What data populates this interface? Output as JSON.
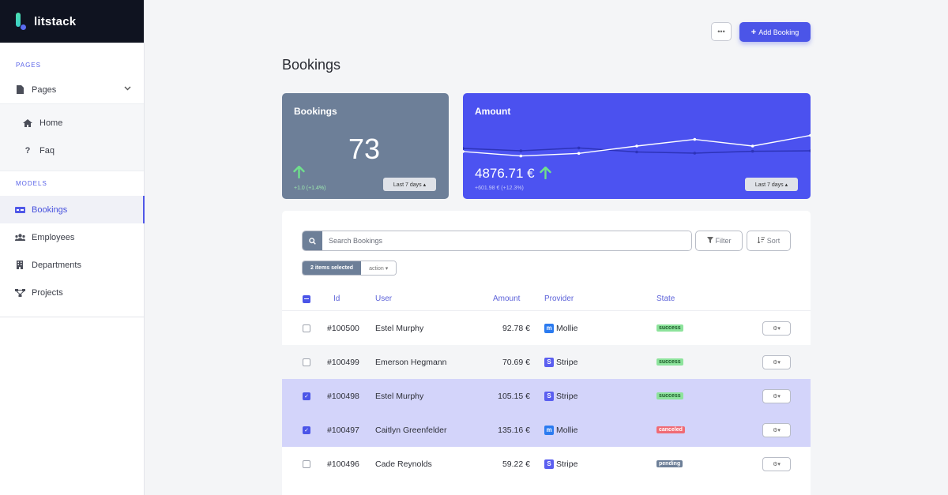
{
  "app": {
    "name": "litstack"
  },
  "sidebar": {
    "pages_label": "PAGES",
    "pages_group": "Pages",
    "pages": [
      {
        "label": "Home",
        "icon": "home-icon"
      },
      {
        "label": "Faq",
        "icon": "question-icon"
      }
    ],
    "models_label": "MODELS",
    "models": [
      {
        "label": "Bookings",
        "icon": "bookings-icon",
        "active": true
      },
      {
        "label": "Employees",
        "icon": "users-icon"
      },
      {
        "label": "Departments",
        "icon": "building-icon"
      },
      {
        "label": "Projects",
        "icon": "network-icon"
      }
    ]
  },
  "header": {
    "more_label": "•••",
    "add_label": "Add Booking",
    "title": "Bookings"
  },
  "cards": {
    "bookings": {
      "title": "Bookings",
      "value": "73",
      "delta": "+1.0 (+1.4%)",
      "range": "Last 7 days ▴"
    },
    "amount": {
      "title": "Amount",
      "value": "4876.71 €",
      "delta": "+601.98 € (+12.3%)",
      "range": "Last 7 days ▴"
    }
  },
  "chart_data": {
    "type": "line",
    "title": "Amount",
    "x": [
      1,
      2,
      3,
      4,
      5,
      6,
      7
    ],
    "series": [
      {
        "values": [
          0.4,
          0.3,
          0.42,
          0.25,
          0.2,
          0.28,
          0.3
        ]
      },
      {
        "values": [
          0.27,
          0.08,
          0.19,
          0.5,
          0.78,
          0.5,
          0.95
        ]
      }
    ],
    "grid": false,
    "axes_visible": false
  },
  "toolbar": {
    "search_placeholder": "Search Bookings",
    "filter_label": "Filter",
    "sort_label": "Sort",
    "selected_label": "2 items selected",
    "action_label": "action ▾"
  },
  "table": {
    "columns": [
      "Id",
      "User",
      "Amount",
      "Provider",
      "State"
    ],
    "rows": [
      {
        "id": "#100500",
        "user": "Estel Murphy",
        "amount": "92.78 €",
        "provider": "Mollie",
        "state": "success",
        "checked": false
      },
      {
        "id": "#100499",
        "user": "Emerson Hegmann",
        "amount": "70.69 €",
        "provider": "Stripe",
        "state": "success",
        "checked": false
      },
      {
        "id": "#100498",
        "user": "Estel Murphy",
        "amount": "105.15 €",
        "provider": "Stripe",
        "state": "success",
        "checked": true
      },
      {
        "id": "#100497",
        "user": "Caitlyn Greenfelder",
        "amount": "135.16 €",
        "provider": "Mollie",
        "state": "canceled",
        "checked": true
      },
      {
        "id": "#100496",
        "user": "Cade Reynolds",
        "amount": "59.22 €",
        "provider": "Stripe",
        "state": "pending",
        "checked": false
      }
    ]
  },
  "colors": {
    "accent": "#4b55e8",
    "card_gray": "#6d7f98",
    "card_blue": "#4b51ef",
    "mollie": "#2b7bf0",
    "stripe": "#5b5ff0",
    "success": "#8de39c",
    "canceled": "#f06b75",
    "pending": "#6d7f98",
    "selected_row": "#d3d4fa"
  }
}
